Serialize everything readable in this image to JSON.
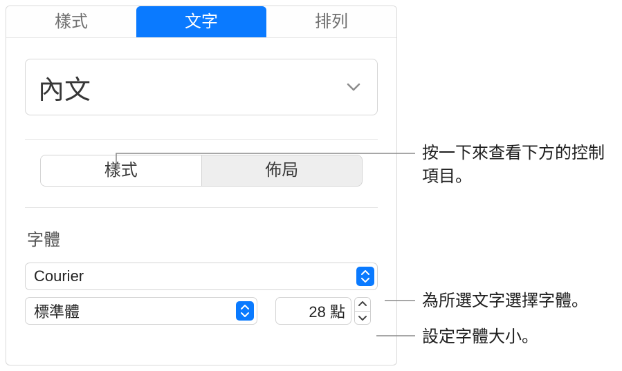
{
  "tabs": {
    "style": "樣式",
    "text": "文字",
    "arrange": "排列"
  },
  "paragraph_style": {
    "selected": "內文"
  },
  "segmented": {
    "style": "樣式",
    "layout": "佈局"
  },
  "font_section": {
    "label": "字體",
    "family": "Courier",
    "face": "標準體",
    "size_value": "28 點"
  },
  "annotations": {
    "segmented_tip": "按一下來查看下方的控制項目。",
    "family_tip": "為所選文字選擇字體。",
    "size_tip": "設定字體大小。"
  }
}
